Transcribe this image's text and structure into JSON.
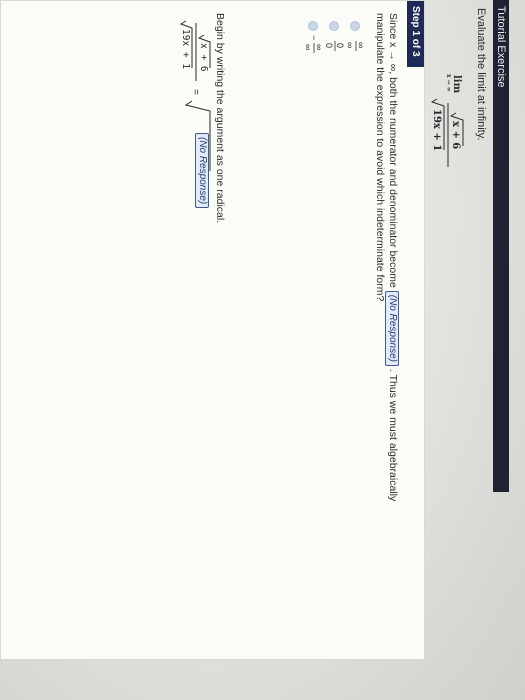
{
  "header": {
    "title": "Tutorial Exercise"
  },
  "intro": {
    "text": "Evaluate the limit at infinity."
  },
  "limit": {
    "lim": "lim",
    "sub": "x → ∞",
    "numerator": "x + 6",
    "denominator": "19x + 1"
  },
  "step": {
    "label": "Step 1 of 3",
    "question_part1": "Since x → ∞, both the numerator and denominator become",
    "response": "(No Response)",
    "question_part2": ". Thus we must algebraically",
    "question_line2": "manipulate the expression to avoid which indeterminate form?",
    "options": [
      {
        "num": "∞",
        "den": "∞",
        "sign": ""
      },
      {
        "num": "0",
        "den": "0",
        "sign": ""
      },
      {
        "num": "∞",
        "den": "∞",
        "sign": "−"
      }
    ],
    "instruction": "Begin by writing the argument as one radical.",
    "eq_numerator": "x + 6",
    "eq_denominator": "19x + 1",
    "eq_sign": "=",
    "eq_response": "(No Response)"
  }
}
